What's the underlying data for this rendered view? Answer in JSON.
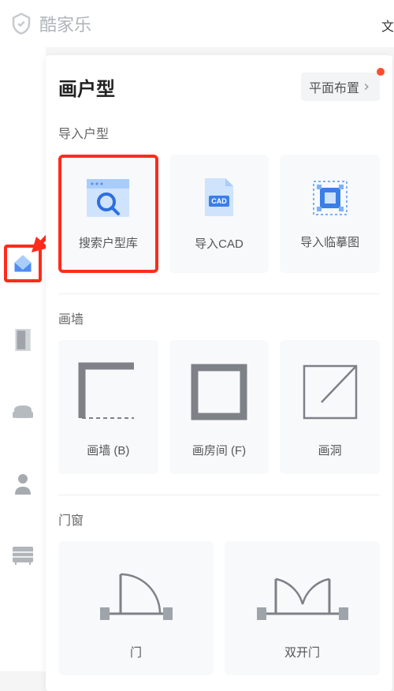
{
  "app": {
    "name": "酷家乐"
  },
  "topbar": {
    "right": "文"
  },
  "panel": {
    "title": "画户型",
    "layout_btn": "平面布置"
  },
  "sections": {
    "import": {
      "title": "导入户型",
      "cards": {
        "search": "搜索户型库",
        "cad": "导入CAD",
        "trace": "导入临摹图"
      }
    },
    "wall": {
      "title": "画墙",
      "cards": {
        "wall": "画墙 (B)",
        "room": "画房间 (F)",
        "hole": "画洞"
      }
    },
    "door": {
      "title": "门窗",
      "cards": {
        "single": "门",
        "double": "双开门"
      }
    }
  }
}
